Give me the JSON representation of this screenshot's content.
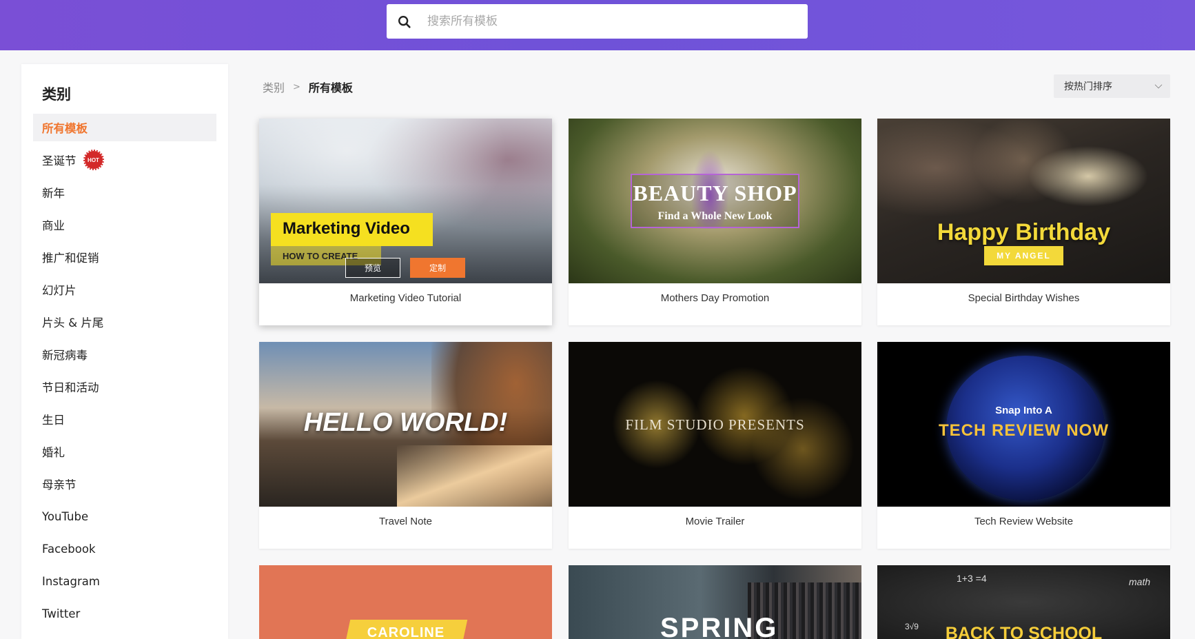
{
  "search": {
    "placeholder": "搜索所有模板"
  },
  "sidebar": {
    "title": "类别",
    "items": [
      {
        "label": "所有模板",
        "active": true
      },
      {
        "label": "圣诞节",
        "badge": "HOT"
      },
      {
        "label": "新年"
      },
      {
        "label": "商业"
      },
      {
        "label": "推广和促销"
      },
      {
        "label": "幻灯片"
      },
      {
        "label": "片头 & 片尾"
      },
      {
        "label": "新冠病毒"
      },
      {
        "label": "节日和活动"
      },
      {
        "label": "生日"
      },
      {
        "label": "婚礼"
      },
      {
        "label": "母亲节"
      },
      {
        "label": "YouTube"
      },
      {
        "label": "Facebook"
      },
      {
        "label": "Instagram"
      },
      {
        "label": "Twitter"
      }
    ]
  },
  "breadcrumb": {
    "root": "类别",
    "separator": ">",
    "current": "所有模板"
  },
  "sort": {
    "label": "按热门排序"
  },
  "hover_actions": {
    "preview": "预览",
    "customize": "定制"
  },
  "templates": [
    {
      "name": "Marketing Video Tutorial",
      "title": "Marketing Video",
      "subtitle": "HOW TO CREATE"
    },
    {
      "name": "Mothers Day Promotion",
      "title": "BEAUTY SHOP",
      "subtitle": "Find a Whole New Look"
    },
    {
      "name": "Special Birthday Wishes",
      "title": "Happy Birthday",
      "subtitle": "MY ANGEL"
    },
    {
      "name": "Travel Note",
      "title": "HELLO WORLD!"
    },
    {
      "name": "Movie Trailer",
      "title": "FILM STUDIO PRESENTS"
    },
    {
      "name": "Tech Review Website",
      "title": "TECH REVIEW NOW",
      "subtitle": "Snap Into A"
    },
    {
      "title": "CAROLINE"
    },
    {
      "title": "SPRING"
    },
    {
      "title": "BACK TO SCHOOL",
      "extra": [
        "1+3 =4",
        "math",
        "3√9"
      ]
    }
  ],
  "colors": {
    "accent": "#f0762f",
    "header": "#7152d8",
    "hot": "#d32929"
  }
}
